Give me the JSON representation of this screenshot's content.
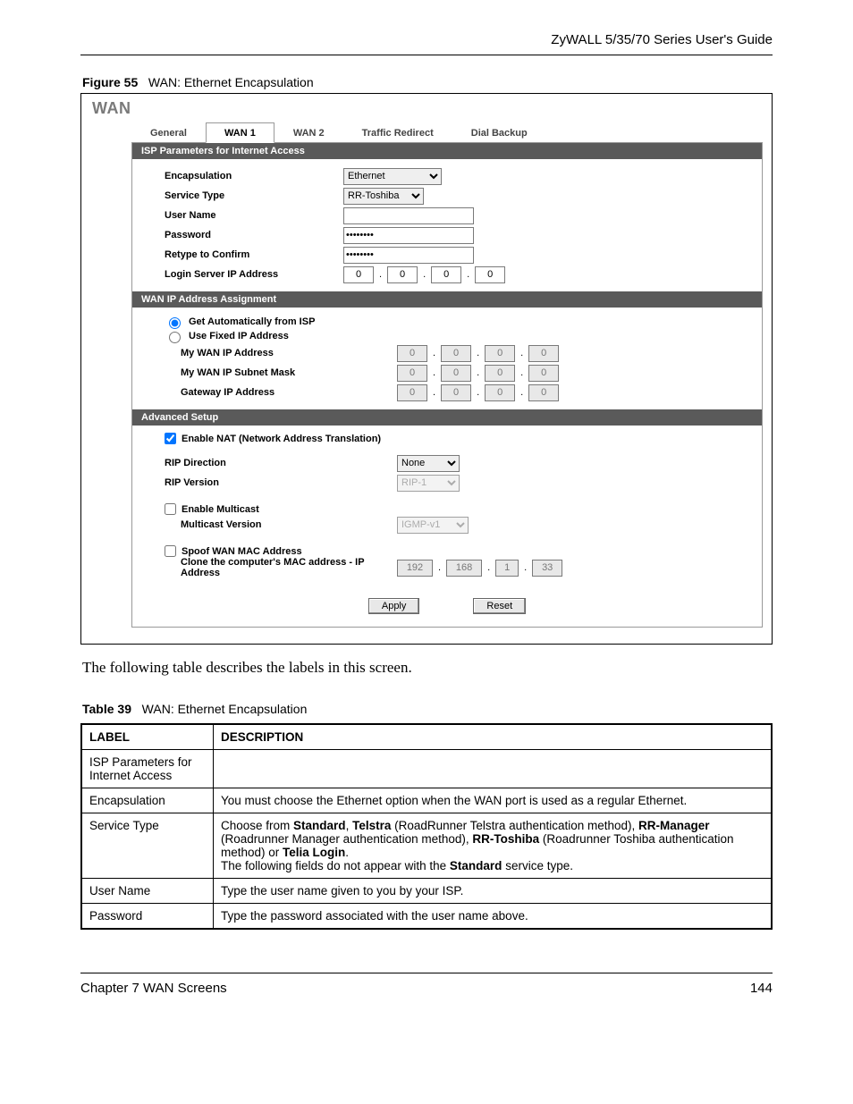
{
  "doc": {
    "running_head": "ZyWALL 5/35/70 Series User's Guide",
    "figure_label": "Figure 55",
    "figure_title": "WAN: Ethernet Encapsulation",
    "body_text": "The following table describes the labels in this screen.",
    "table_label": "Table 39",
    "table_title": "WAN: Ethernet Encapsulation",
    "footer_left": "Chapter 7 WAN Screens",
    "footer_right": "144"
  },
  "shot": {
    "title": "WAN",
    "tabs": [
      "General",
      "WAN 1",
      "WAN 2",
      "Traffic Redirect",
      "Dial Backup"
    ],
    "active_tab": 1,
    "sec1": "ISP Parameters for Internet Access",
    "sec2": "WAN IP Address Assignment",
    "sec3": "Advanced Setup",
    "labels": {
      "encap": "Encapsulation",
      "svc": "Service Type",
      "user": "User Name",
      "pass": "Password",
      "retype": "Retype to Confirm",
      "login_srv": "Login Server IP Address",
      "get_auto": "Get Automatically from ISP",
      "use_fixed": "Use Fixed IP Address",
      "my_ip": "My WAN IP Address",
      "my_mask": "My WAN IP Subnet Mask",
      "gw": "Gateway IP Address",
      "enable_nat": "Enable NAT (Network Address Translation)",
      "rip_dir": "RIP Direction",
      "rip_ver": "RIP Version",
      "enable_mc": "Enable Multicast",
      "mc_ver": "Multicast Version",
      "spoof": "Spoof WAN MAC Address",
      "clone": "Clone the computer's MAC address - IP Address"
    },
    "values": {
      "encap": "Ethernet",
      "svc": "RR-Toshiba",
      "user": "",
      "pass": "********",
      "retype": "********",
      "login_ip": [
        "0",
        "0",
        "0",
        "0"
      ],
      "ip_mode": "auto",
      "my_ip": [
        "0",
        "0",
        "0",
        "0"
      ],
      "my_mask": [
        "0",
        "0",
        "0",
        "0"
      ],
      "gw": [
        "0",
        "0",
        "0",
        "0"
      ],
      "enable_nat": true,
      "rip_dir": "None",
      "rip_ver": "RIP-1",
      "enable_mc": false,
      "mc_ver": "IGMP-v1",
      "spoof": false,
      "clone_ip": [
        "192",
        "168",
        "1",
        "33"
      ]
    },
    "buttons": {
      "apply": "Apply",
      "reset": "Reset"
    }
  },
  "table": {
    "head": {
      "label": "LABEL",
      "desc": "DESCRIPTION"
    },
    "rows": [
      {
        "l": "ISP Parameters for Internet Access",
        "d": ""
      },
      {
        "l": "Encapsulation",
        "d": "You must choose the Ethernet option when the WAN port is used as a regular Ethernet."
      },
      {
        "l": "Service Type",
        "d_html": "Choose from <b>Standard</b>, <b>Telstra</b> (RoadRunner Telstra authentication method), <b>RR-Manager</b> (Roadrunner Manager authentication method), <b>RR-Toshiba</b> (Roadrunner Toshiba authentication method) or <b>Telia Login</b>.<br>The following fields do not appear with the <b>Standard</b> service type."
      },
      {
        "l": "User Name",
        "d": "Type the user name given to you by your ISP."
      },
      {
        "l": "Password",
        "d": "Type the password associated with the user name above."
      }
    ]
  }
}
